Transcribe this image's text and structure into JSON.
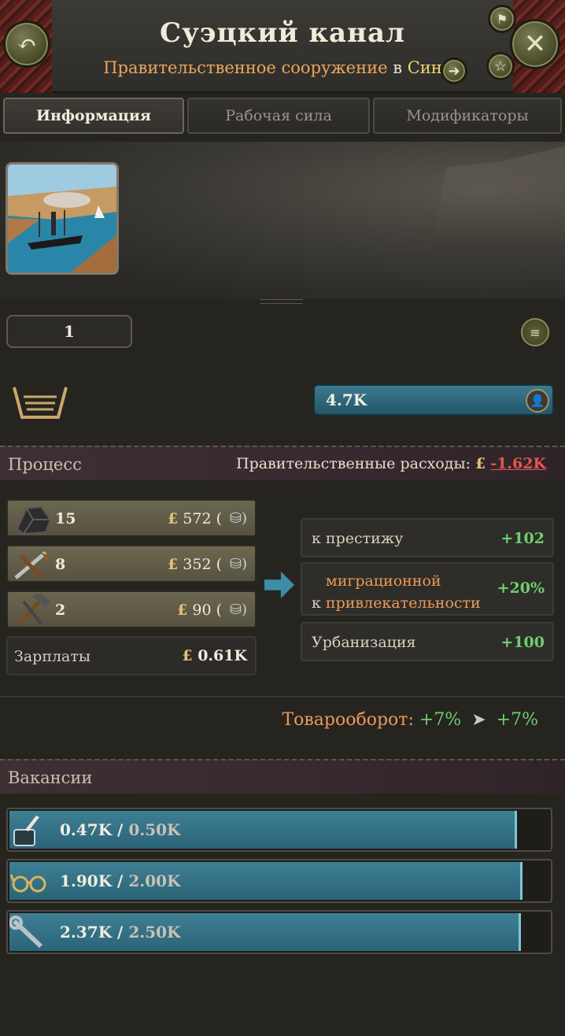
{
  "header": {
    "title": "Суэцкий канал",
    "subtitle_type": "Правительственное сооружение",
    "subtitle_in": "в",
    "subtitle_region": "Синае"
  },
  "tabs": [
    {
      "label": "Информация",
      "active": true
    },
    {
      "label": "Рабочая сила",
      "active": false
    },
    {
      "label": "Модификаторы",
      "active": false
    }
  ],
  "building": {
    "level": "1",
    "workforce": "4.7K"
  },
  "process": {
    "title": "Процесс",
    "gov_expenses_label": "Правительственные расходы:",
    "gov_expenses_currency": "£",
    "gov_expenses_value": "-1.62K",
    "inputs": [
      {
        "icon": "coal-icon",
        "qty": "15",
        "currency": "£",
        "value": "572"
      },
      {
        "icon": "tools-icon",
        "qty": "8",
        "currency": "£",
        "value": "352"
      },
      {
        "icon": "hammer-icon",
        "qty": "2",
        "currency": "£",
        "value": "90"
      }
    ],
    "wages_label": "Зарплаты",
    "wages_currency": "£",
    "wages_value": "0.61K",
    "effects": [
      {
        "label": "к престижу",
        "value": "+102"
      },
      {
        "label_prefix": "к",
        "label_highlight": "миграционной привлекательности",
        "value": "+20%"
      },
      {
        "label": "Урбанизация",
        "value": "+100"
      }
    ],
    "trade_label": "Товарооборот:",
    "trade_from": "+7%",
    "trade_to": "+7%"
  },
  "vacancies": {
    "title": "Вакансии",
    "rows": [
      {
        "icon": "clerk-icon",
        "filled": "0.47K",
        "total": "0.50K",
        "fill_ratio": 0.94
      },
      {
        "icon": "engineer-icon",
        "filled": "1.90K",
        "total": "2.00K",
        "fill_ratio": 0.95
      },
      {
        "icon": "laborer-icon",
        "filled": "2.37K",
        "total": "2.50K",
        "fill_ratio": 0.948
      }
    ]
  },
  "colors": {
    "accent_orange": "#eb9a5a",
    "positive_green": "#6fcf6f",
    "negative_red": "#e0574f",
    "bar_teal": "#3e7f94"
  }
}
